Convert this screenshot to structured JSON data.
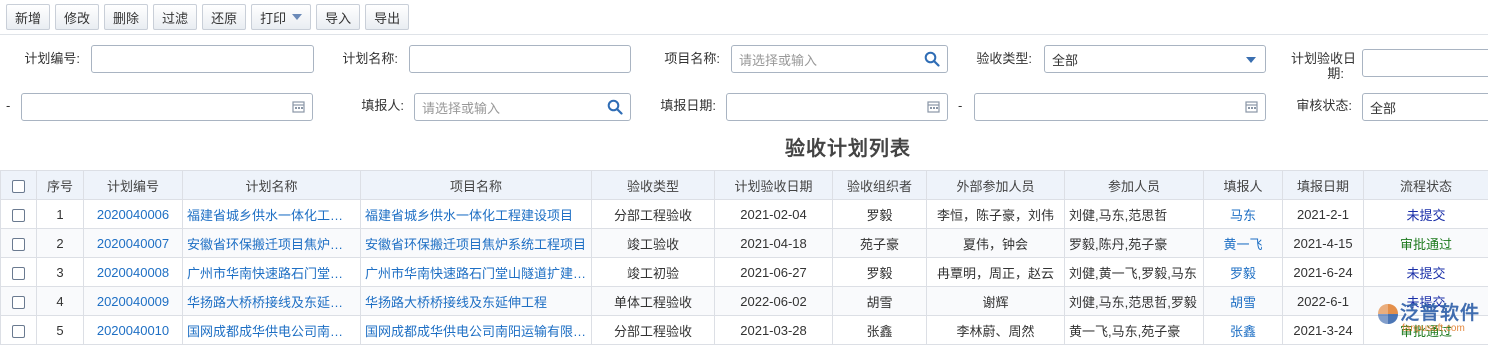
{
  "toolbar": {
    "add": "新增",
    "edit": "修改",
    "delete": "删除",
    "filter": "过滤",
    "restore": "还原",
    "print": "打印",
    "import": "导入",
    "export": "导出"
  },
  "form": {
    "plan_no_label": "计划编号:",
    "plan_name_label": "计划名称:",
    "project_name_label": "项目名称:",
    "project_name_placeholder": "请选择或输入",
    "accept_type_label": "验收类型:",
    "accept_type_value": "全部",
    "plan_date_label_1": "计划验收日",
    "plan_date_label_2": "期:",
    "range_dash": "-",
    "reporter_label": "填报人:",
    "reporter_placeholder": "请选择或输入",
    "report_date_label": "填报日期:",
    "review_status_label": "审核状态:",
    "review_status_value": "全部"
  },
  "list_title": "验收计划列表",
  "table": {
    "headers": [
      "序号",
      "计划编号",
      "计划名称",
      "项目名称",
      "验收类型",
      "计划验收日期",
      "验收组织者",
      "外部参加人员",
      "参加人员",
      "填报人",
      "填报日期",
      "流程状态"
    ],
    "rows": [
      {
        "seq": "1",
        "plan_no": "2020040006",
        "plan_name": "福建省城乡供水一体化工程建设项目",
        "project": "福建省城乡供水一体化工程建设项目",
        "type": "分部工程验收",
        "plan_date": "2021-02-04",
        "organizer": "罗毅",
        "external": "李恒，陈子豪，刘伟",
        "participants": "刘健,马东,范思哲",
        "reporter": "马东",
        "report_date": "2021-2-1",
        "status": "未提交"
      },
      {
        "seq": "2",
        "plan_no": "2020040007",
        "plan_name": "安徽省环保搬迁项目焦炉系统工程",
        "project": "安徽省环保搬迁项目焦炉系统工程项目",
        "type": "竣工验收",
        "plan_date": "2021-04-18",
        "organizer": "苑子豪",
        "external": "夏伟，钟会",
        "participants": "罗毅,陈丹,苑子豪",
        "reporter": "黄一飞",
        "report_date": "2021-4-15",
        "status": "审批通过"
      },
      {
        "seq": "3",
        "plan_no": "2020040008",
        "plan_name": "广州市华南快速路石门堂山隧道工程",
        "project": "广州市华南快速路石门堂山隧道扩建工程",
        "type": "竣工初验",
        "plan_date": "2021-06-27",
        "organizer": "罗毅",
        "external": "冉覃明，周正，赵云",
        "participants": "刘健,黄一飞,罗毅,马东",
        "reporter": "罗毅",
        "report_date": "2021-6-24",
        "status": "未提交"
      },
      {
        "seq": "4",
        "plan_no": "2020040009",
        "plan_name": "华扬路大桥桥接线及东延伸工程项目",
        "project": "华扬路大桥桥接线及东延伸工程",
        "type": "单体工程验收",
        "plan_date": "2022-06-02",
        "organizer": "胡雪",
        "external": "谢辉",
        "participants": "刘健,马东,范思哲,罗毅",
        "reporter": "胡雪",
        "report_date": "2022-6-1",
        "status": "未提交"
      },
      {
        "seq": "5",
        "plan_no": "2020040010",
        "plan_name": "国网成都成华供电公司南阳运输工程",
        "project": "国网成都成华供电公司南阳运输有限公司",
        "type": "分部工程验收",
        "plan_date": "2021-03-28",
        "organizer": "张鑫",
        "external": "李林蔚、周然",
        "participants": "黄一飞,马东,苑子豪",
        "reporter": "张鑫",
        "report_date": "2021-3-24",
        "status": "审批通过"
      }
    ]
  },
  "watermark": {
    "brand": "泛普软件",
    "site": "fanpusoft.com"
  },
  "colors": {
    "link": "#1e6fc4",
    "status_pending": "#1a2fa8",
    "status_approved": "#1e7a1e",
    "header_bg": "#eef3fa"
  }
}
